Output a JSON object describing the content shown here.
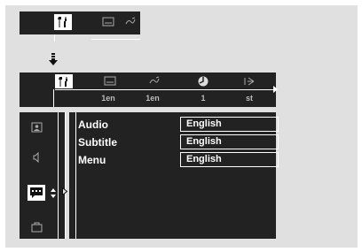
{
  "top_bar": {
    "icons": [
      "settings-icon",
      "subtitle-icon",
      "audio-icon"
    ]
  },
  "menu_bar": {
    "icons": [
      "settings-icon",
      "subtitle-icon",
      "audio-icon",
      "angle-icon",
      "zoom-icon"
    ],
    "values": [
      "1en",
      "1en",
      "1",
      "st"
    ]
  },
  "left_panel": {
    "icons": [
      "picture-icon",
      "speaker-icon",
      "language-icon",
      "misc-icon"
    ]
  },
  "language_menu": {
    "rows": [
      {
        "label": "Audio",
        "value": "English"
      },
      {
        "label": "Subtitle",
        "value": "English"
      },
      {
        "label": "Menu",
        "value": "English"
      }
    ]
  },
  "colors": {
    "panel": "#222222",
    "background": "#e0e0e0",
    "highlight": "#ffffff"
  }
}
